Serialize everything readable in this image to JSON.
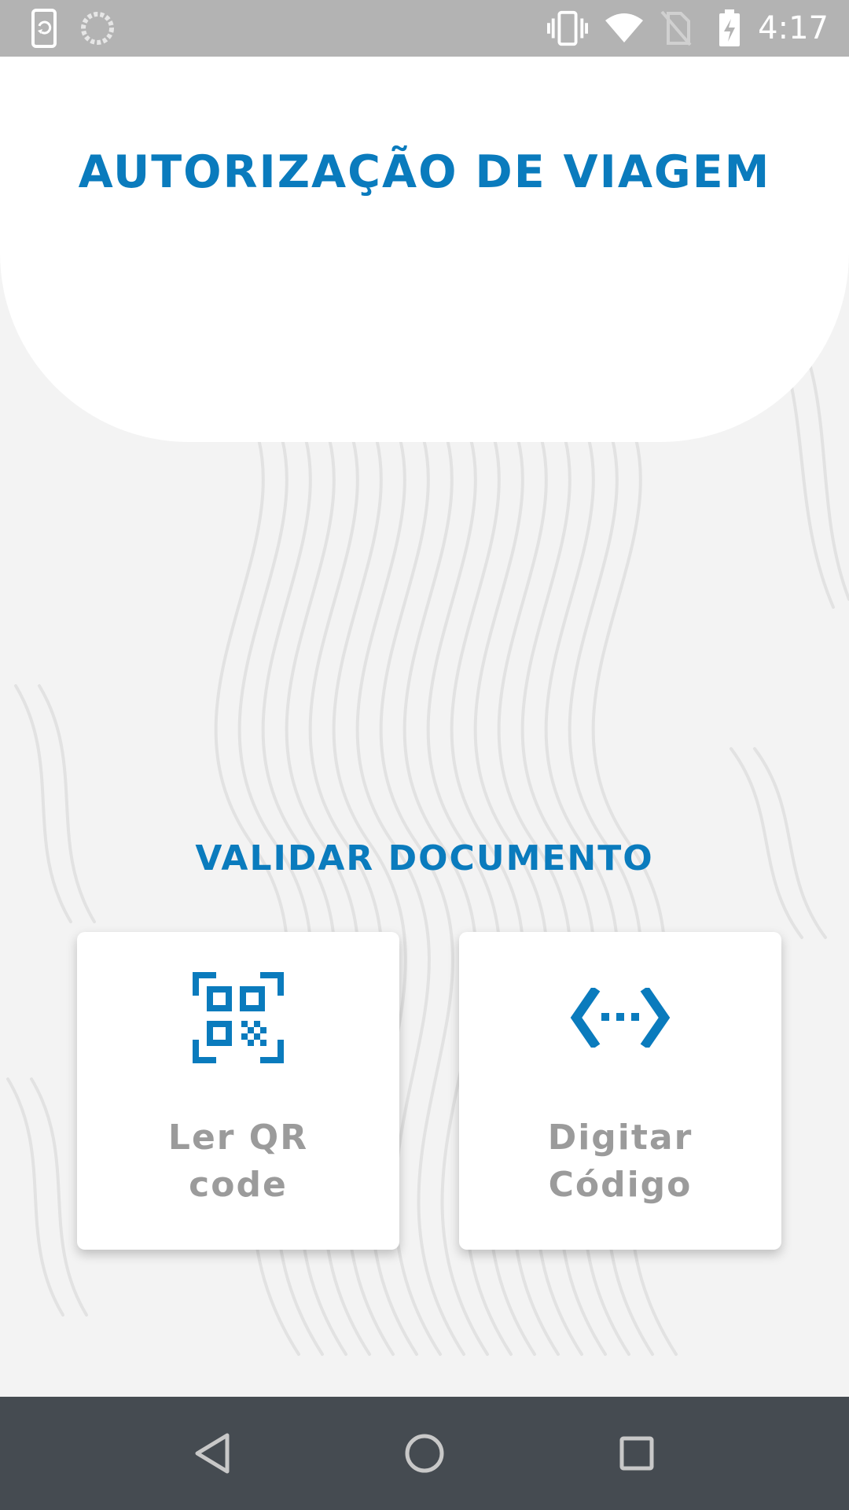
{
  "status_bar": {
    "time": "4:17",
    "icons_left": [
      "screen-rotation-icon",
      "loading-spinner-icon"
    ],
    "icons_right": [
      "vibrate-icon",
      "wifi-icon",
      "no-sim-icon",
      "battery-charging-icon"
    ]
  },
  "header": {
    "title": "AUTORIZAÇÃO DE VIAGEM"
  },
  "main": {
    "section_title": "VALIDAR DOCUMENTO",
    "options": [
      {
        "label": "Ler QR\ncode",
        "icon": "qr-code-scan-icon"
      },
      {
        "label": "Digitar\nCódigo",
        "icon": "code-input-icon"
      }
    ]
  },
  "nav_bar": {
    "buttons": [
      "back-icon",
      "home-icon",
      "recents-icon"
    ]
  },
  "colors": {
    "accent": "#0a7bbd",
    "label_gray": "#9b9b9b",
    "background": "#f3f3f3",
    "status_bar": "#b3b3b3",
    "nav_bar": "#454b51"
  }
}
